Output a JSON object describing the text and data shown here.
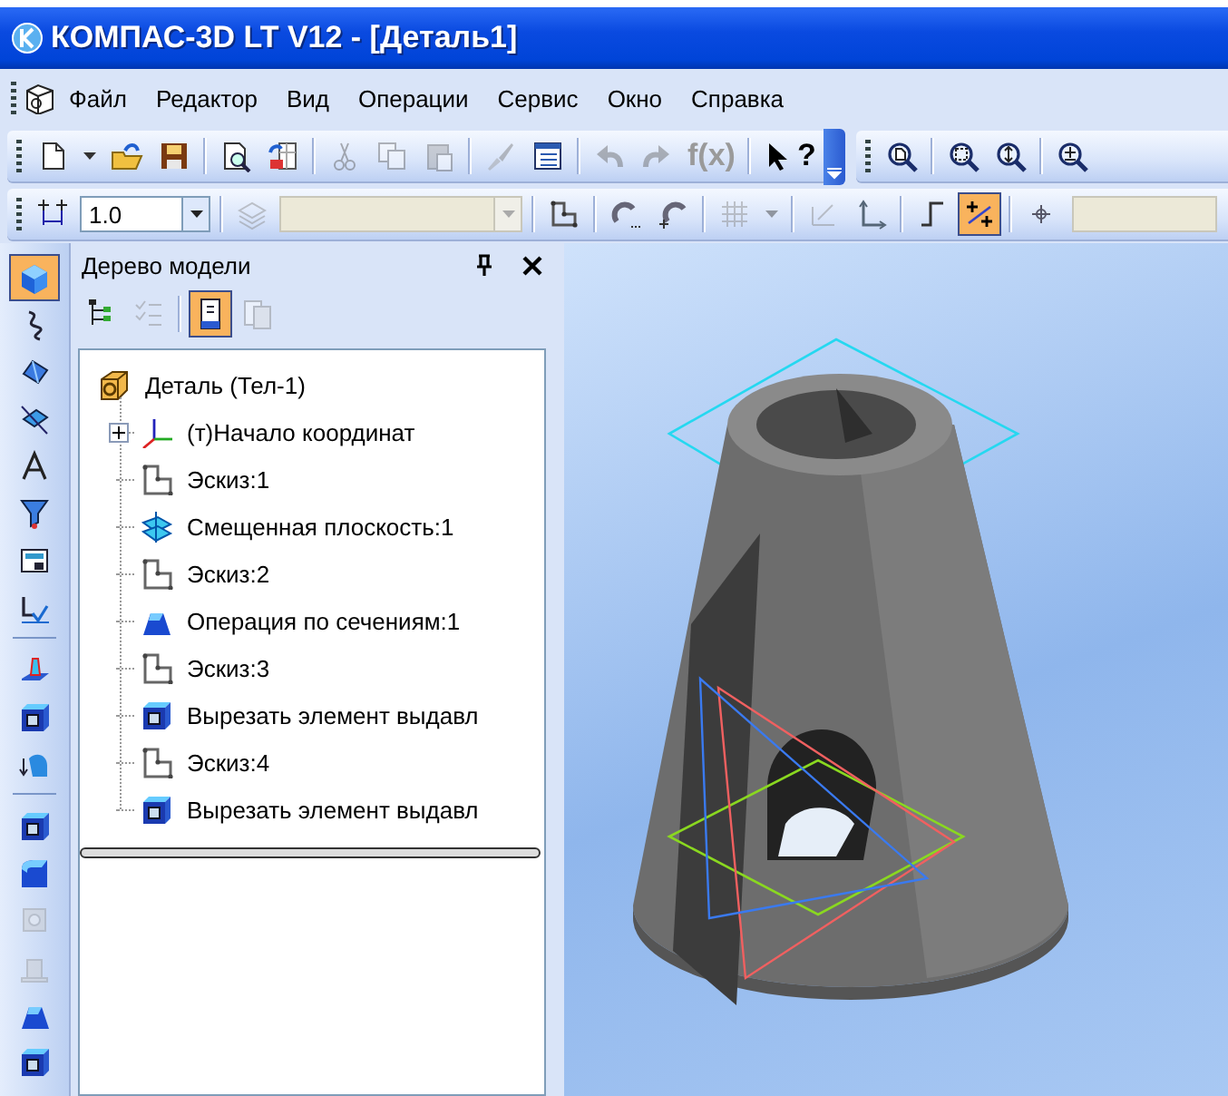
{
  "window": {
    "title": "КОМПАС-3D LT V12 - [Деталь1]"
  },
  "menu": [
    "Файл",
    "Редактор",
    "Вид",
    "Операции",
    "Сервис",
    "Окно",
    "Справка"
  ],
  "toolbar_standard": {
    "groups": [
      [
        {
          "kind": "new",
          "disabled": false
        },
        {
          "kind": "caret",
          "disabled": false
        },
        {
          "kind": "open",
          "disabled": false
        },
        {
          "kind": "save",
          "disabled": false
        }
      ],
      [
        {
          "kind": "preview",
          "disabled": false
        },
        {
          "kind": "sheet",
          "disabled": false
        }
      ],
      [
        {
          "kind": "cut",
          "disabled": true
        },
        {
          "kind": "copy",
          "disabled": true
        },
        {
          "kind": "paste",
          "disabled": true
        }
      ],
      [
        {
          "kind": "brush",
          "disabled": true
        },
        {
          "kind": "table",
          "disabled": false
        }
      ],
      [
        {
          "kind": "undo",
          "disabled": true
        },
        {
          "kind": "redo",
          "disabled": true
        },
        {
          "kind": "fx",
          "label": "f(x)",
          "disabled": true
        }
      ],
      [
        {
          "kind": "help",
          "label": "?",
          "disabled": false
        }
      ]
    ]
  },
  "toolbar_view": {
    "groups": [
      [
        {
          "kind": "zoom-page",
          "disabled": false
        }
      ],
      [
        {
          "kind": "zoom-window",
          "disabled": false
        },
        {
          "kind": "zoom-scale",
          "disabled": false
        }
      ],
      [
        {
          "kind": "zoom-in",
          "disabled": false
        }
      ]
    ]
  },
  "toolbar_current": {
    "groups": [
      [
        {
          "kind": "step-dim",
          "selected": false,
          "disabled": false
        },
        {
          "kind": "combo",
          "value": "1.0",
          "disabled": false
        }
      ],
      [
        {
          "kind": "layers",
          "selected": false,
          "disabled": true
        },
        {
          "kind": "combo",
          "disabled": true
        }
      ],
      [
        {
          "kind": "sketch",
          "selected": false,
          "disabled": false
        }
      ],
      [
        {
          "kind": "magnet",
          "selected": false,
          "disabled": false
        },
        {
          "kind": "magnet2",
          "selected": false,
          "disabled": false
        }
      ],
      [
        {
          "kind": "grid",
          "selected": false,
          "disabled": true
        },
        {
          "kind": "caret",
          "selected": false,
          "disabled": true
        }
      ],
      [
        {
          "kind": "local-cs",
          "selected": false,
          "disabled": true
        },
        {
          "kind": "axes",
          "selected": false,
          "disabled": false
        }
      ],
      [
        {
          "kind": "step-line",
          "selected": false,
          "disabled": false
        },
        {
          "kind": "ortho",
          "selected": true,
          "disabled": false
        }
      ],
      [
        {
          "kind": "coords",
          "selected": false,
          "disabled": false
        },
        {
          "kind": "coord-field"
        }
      ]
    ]
  },
  "compact_toolbar": {
    "groups": [
      [
        {
          "kind": "part",
          "selected": true,
          "disabled": false
        },
        {
          "kind": "curve",
          "selected": false,
          "disabled": false
        },
        {
          "kind": "surface",
          "selected": false,
          "disabled": false
        },
        {
          "kind": "spatial",
          "selected": false,
          "disabled": false
        },
        {
          "kind": "dims",
          "selected": false,
          "disabled": false
        },
        {
          "kind": "filter",
          "selected": false,
          "disabled": false
        },
        {
          "kind": "report",
          "selected": false,
          "disabled": false
        },
        {
          "kind": "spec",
          "selected": false,
          "disabled": false
        }
      ],
      [
        {
          "kind": "extrude",
          "selected": false,
          "disabled": false
        },
        {
          "kind": "cut-box",
          "selected": false,
          "disabled": false
        },
        {
          "kind": "rotate",
          "selected": false,
          "disabled": false
        }
      ],
      [
        {
          "kind": "cut-box",
          "selected": false,
          "disabled": false
        },
        {
          "kind": "fillet",
          "selected": false,
          "disabled": false
        },
        {
          "kind": "hole",
          "selected": false,
          "disabled": true
        },
        {
          "kind": "rib",
          "selected": false,
          "disabled": true
        },
        {
          "kind": "loft",
          "selected": false,
          "disabled": false
        },
        {
          "kind": "cut-box",
          "selected": false,
          "disabled": false
        }
      ]
    ]
  },
  "tree_panel": {
    "title": "Дерево модели",
    "toolbar": [
      {
        "kind": "tree-structure",
        "selected": false,
        "disabled": false
      },
      {
        "kind": "checklist",
        "selected": false,
        "disabled": true
      },
      {
        "kind": "model-view",
        "selected": true,
        "disabled": false
      },
      {
        "kind": "copy-view",
        "selected": false,
        "disabled": true
      }
    ],
    "root": {
      "label": "Деталь (Тел-1)",
      "kind": "part",
      "children": [
        {
          "label": "(т)Начало координат",
          "kind": "origin",
          "expanded": false
        },
        {
          "label": "Эскиз:1",
          "kind": "sketch"
        },
        {
          "label": "Смещенная плоскость:1",
          "kind": "plane"
        },
        {
          "label": "Эскиз:2",
          "kind": "sketch"
        },
        {
          "label": "Операция по сечениям:1",
          "kind": "loft"
        },
        {
          "label": "Эскиз:3",
          "kind": "sketch"
        },
        {
          "label": "Вырезать элемент выдавл",
          "kind": "cut"
        },
        {
          "label": "Эскиз:4",
          "kind": "sketch"
        },
        {
          "label": "Вырезать элемент выдавл",
          "kind": "cut"
        }
      ]
    }
  }
}
